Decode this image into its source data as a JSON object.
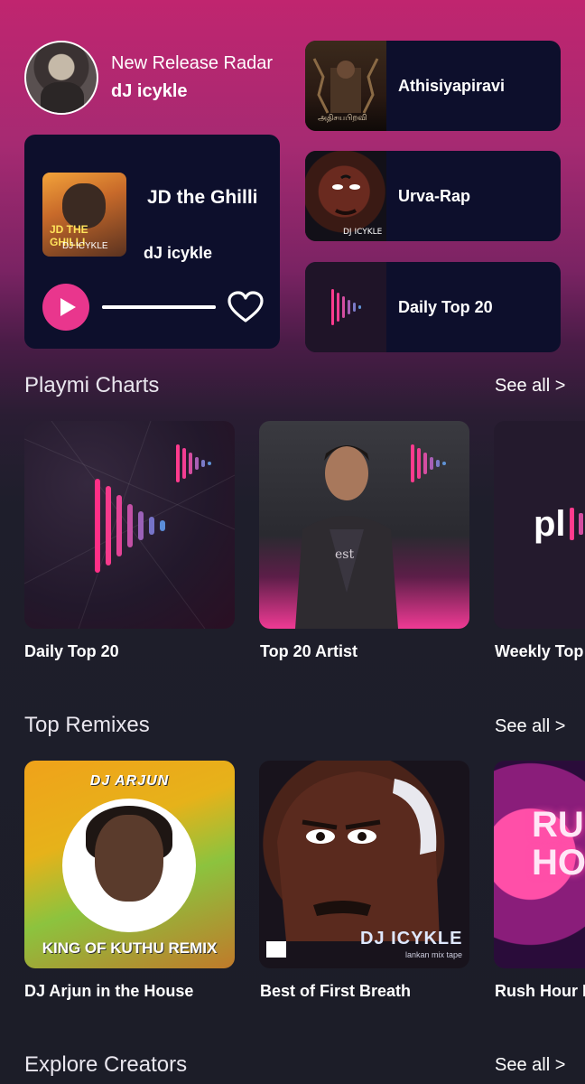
{
  "release_radar": {
    "label": "New Release Radar",
    "artist": "dJ icykle"
  },
  "player": {
    "title": "JD the Ghilli",
    "artist": "dJ icykle",
    "progress": 1.0,
    "art_text": "JD THE GHILLI",
    "art_logo": "DJ ICYKLE"
  },
  "mini_cards": [
    {
      "title": "Athisiyapiravi",
      "icon": "throne-art"
    },
    {
      "title": "Urva-Rap",
      "icon": "face-art"
    },
    {
      "title": "Daily Top 20",
      "icon": "playmi-logo"
    }
  ],
  "sections": {
    "charts": {
      "title": "Playmi Charts",
      "see_all": "See all >",
      "items": [
        {
          "label": "Daily Top 20"
        },
        {
          "label": "Top 20 Artist"
        },
        {
          "label": "Weekly Top",
          "art_text": "pl"
        }
      ]
    },
    "remixes": {
      "title": "Top Remixes",
      "see_all": "See all >",
      "items": [
        {
          "label": "DJ Arjun in the House",
          "art_tag": "DJ ARJUN",
          "art_sub": "KING OF KUTHU REMIX"
        },
        {
          "label": "Best of First Breath",
          "art_logo": "DJ ICYKLE",
          "art_sub": "lankan mix tape"
        },
        {
          "label": "Rush Hour R",
          "art_text": "RU HO"
        }
      ]
    },
    "creators": {
      "title": "Explore Creators",
      "see_all": "See all >"
    }
  },
  "colors": {
    "accent": "#e9368d",
    "card_bg": "#0d0f2c",
    "page_bg": "#1c1d28"
  }
}
